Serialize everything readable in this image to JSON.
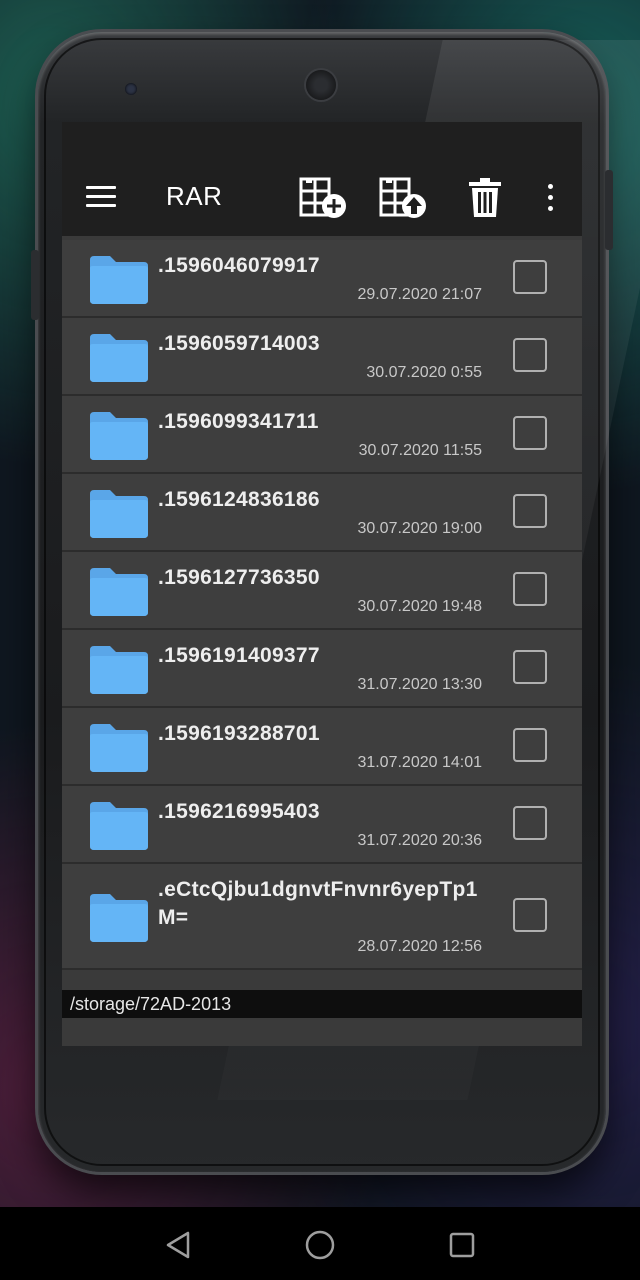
{
  "app": {
    "title": "RAR"
  },
  "toolbar": {
    "icons": [
      "menu-icon",
      "add-to-archive-icon",
      "extract-icon",
      "delete-icon",
      "more-vertical-icon"
    ]
  },
  "files": [
    {
      "name": ".1596046079917",
      "date": "29.07.2020 21:07",
      "checked": false
    },
    {
      "name": ".1596059714003",
      "date": "30.07.2020 0:55",
      "checked": false
    },
    {
      "name": ".1596099341711",
      "date": "30.07.2020 11:55",
      "checked": false
    },
    {
      "name": ".1596124836186",
      "date": "30.07.2020 19:00",
      "checked": false
    },
    {
      "name": ".1596127736350",
      "date": "30.07.2020 19:48",
      "checked": false
    },
    {
      "name": ".1596191409377",
      "date": "31.07.2020 13:30",
      "checked": false
    },
    {
      "name": ".1596193288701",
      "date": "31.07.2020 14:01",
      "checked": false
    },
    {
      "name": ".1596216995403",
      "date": "31.07.2020 20:36",
      "checked": false
    },
    {
      "name": ".eCtcQjbu1dgnvtFnvnr6yepTp1M=",
      "date": "28.07.2020 12:56",
      "checked": false
    }
  ],
  "path": "/storage/72AD-2013",
  "colors": {
    "folder": "#64b5f6",
    "folder_tab": "#5aa6e8",
    "appbar": "#1f1f1f",
    "row": "#3e3e3e"
  },
  "navbar": {
    "icons": [
      "back-icon",
      "home-icon",
      "recents-icon"
    ]
  }
}
